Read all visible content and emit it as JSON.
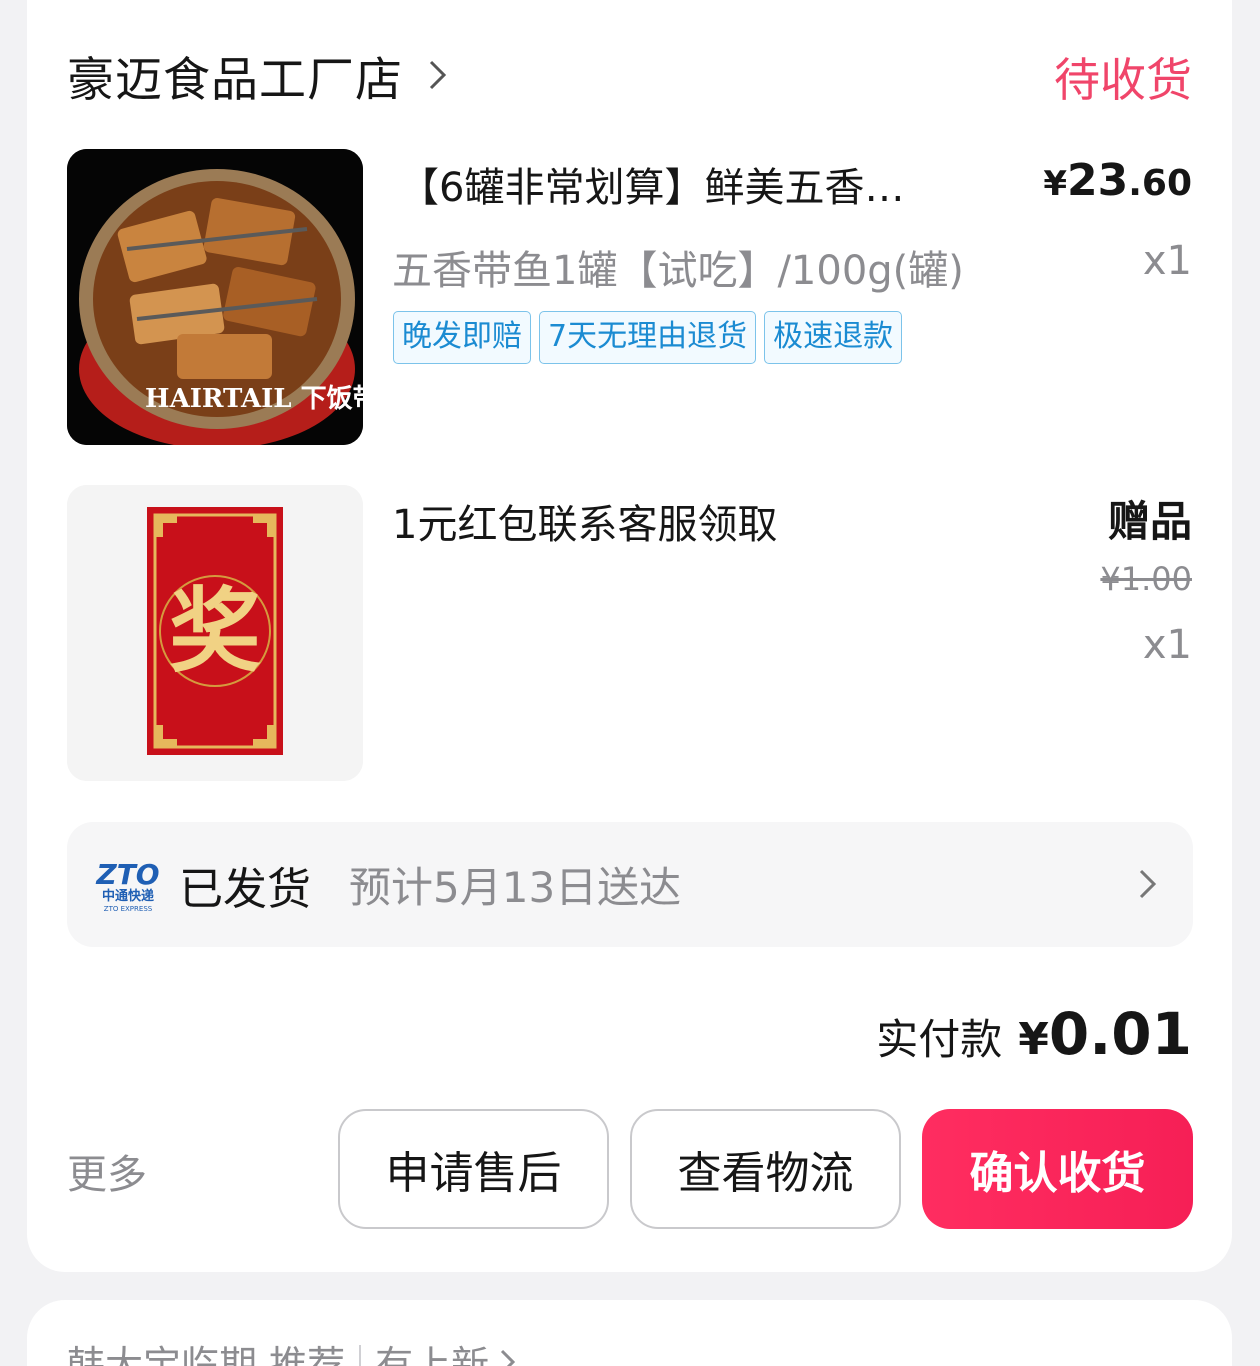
{
  "shop": {
    "name": "豪迈食品工厂店",
    "status": "待收货",
    "status_color": "#f0456a"
  },
  "items": [
    {
      "title": "【6罐非常划算】鲜美五香…",
      "price_symbol": "¥",
      "price_int": "23",
      "price_dec": ".60",
      "sku": "五香带鱼1罐【试吃】/100g(罐)",
      "qty": "x1",
      "image_text": "HAIRTAIL 下饭带鱼",
      "tags": [
        "晚发即赔",
        "7天无理由退货",
        "极速退款"
      ]
    },
    {
      "title": "1元红包联系客服领取",
      "gift_label": "赠品",
      "original_price": "¥1.00",
      "qty": "x1",
      "image_text": "奖"
    }
  ],
  "shipping": {
    "carrier_logo_text": "ZTO",
    "carrier_name": "中通快递",
    "carrier_sub": "ZTO EXPRESS",
    "status": "已发货",
    "eta": "预计5月13日送达"
  },
  "total": {
    "label": "实付款",
    "symbol": "¥",
    "amount": "0.01"
  },
  "actions": {
    "more": "更多",
    "after_sale": "申请售后",
    "view_logistics": "查看物流",
    "confirm_receipt": "确认收货",
    "accent_color": "#ff2d60"
  },
  "recommend": {
    "part1": "韩大宝临期 推荐",
    "part2": "有上新"
  }
}
